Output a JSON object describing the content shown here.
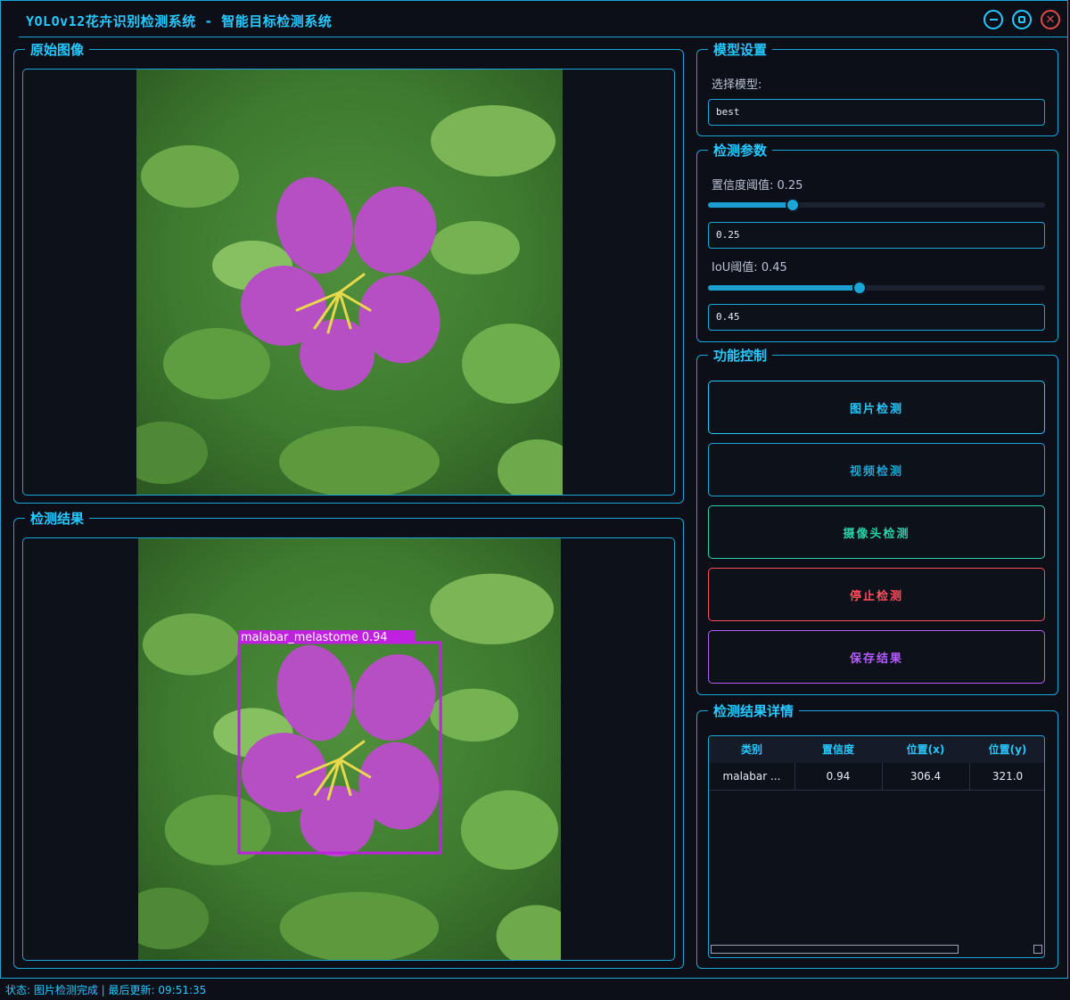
{
  "window": {
    "title": "YOLOv12花卉识别检测系统 - 智能目标检测系统",
    "min_icon": "minimize-icon",
    "max_icon": "maximize-icon",
    "close_icon": "close-icon"
  },
  "original_panel": {
    "title": "原始图像"
  },
  "result_panel": {
    "title": "检测结果",
    "detection_label": "malabar_melastome 0.94",
    "box_color": "#c020e0"
  },
  "model": {
    "title": "模型设置",
    "select_label": "选择模型:",
    "selected": "best"
  },
  "params": {
    "title": "检测参数",
    "conf_label": "置信度阈值: 0.25",
    "conf_value": "0.25",
    "conf_level": 0.25,
    "iou_label": "IoU阈值: 0.45",
    "iou_value": "0.45",
    "iou_level": 0.45
  },
  "controls": {
    "title": "功能控制",
    "image_detect": "图片检测",
    "video_detect": "视频检测",
    "camera_detect": "摄像头检测",
    "stop_detect": "停止检测",
    "save_result": "保存结果"
  },
  "details": {
    "title": "检测结果详情",
    "columns": [
      "类别",
      "置信度",
      "位置(x)",
      "位置(y)"
    ],
    "rows": [
      [
        "malabar ...",
        "0.94",
        "306.4",
        "321.0"
      ]
    ]
  },
  "colors": {
    "accent": "#27c8ff",
    "image_btn": "#27c8ff",
    "video_btn": "#1aa6d8",
    "camera_btn": "#2ad0a8",
    "stop_btn": "#ff4d5e",
    "save_btn": "#b45cff"
  },
  "status": {
    "text": "状态: 图片检测完成 | 最后更新: 09:51:35"
  }
}
